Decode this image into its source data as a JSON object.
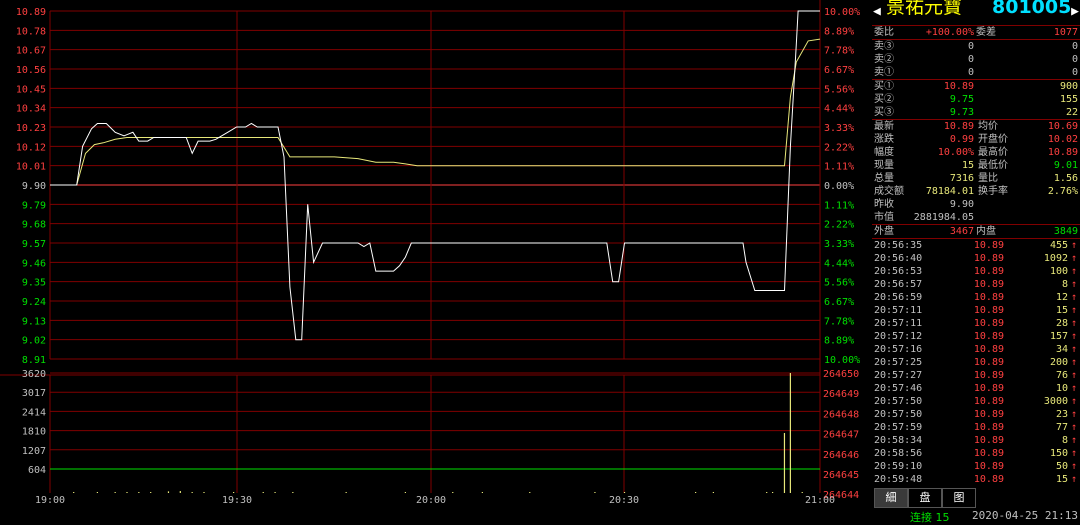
{
  "colors": {
    "background": "#000000",
    "grid": "#800000",
    "up": "#ff4040",
    "down": "#00e000",
    "price_line": "#ffffff",
    "avg_line": "#e8e87a",
    "title": "#ffff00",
    "code": "#00e0ff",
    "neutral": "#c0c0c0"
  },
  "stock": {
    "name": "景祐元寶",
    "code": "801005"
  },
  "price_axis": {
    "left": [
      "10.89",
      "10.78",
      "10.67",
      "10.56",
      "10.45",
      "10.34",
      "10.23",
      "10.12",
      "10.01",
      "9.90",
      "9.79",
      "9.68",
      "9.57",
      "9.46",
      "9.35",
      "9.24",
      "9.13",
      "9.02",
      "8.91"
    ],
    "right": [
      "10.00%",
      "8.89%",
      "7.78%",
      "6.67%",
      "5.56%",
      "4.44%",
      "3.33%",
      "2.22%",
      "1.11%",
      "0.00%",
      "1.11%",
      "2.22%",
      "3.33%",
      "4.44%",
      "5.56%",
      "6.67%",
      "7.78%",
      "8.89%",
      "10.00%"
    ]
  },
  "volume_axis": {
    "left": [
      "3620",
      "3017",
      "2414",
      "1810",
      "1207",
      "604"
    ],
    "right": [
      "264650",
      "264649",
      "264648",
      "264647",
      "264646",
      "264645",
      "264644"
    ]
  },
  "time_axis": [
    "19:00",
    "19:30",
    "20:00",
    "20:30",
    "21:00"
  ],
  "chart_data": {
    "type": "line",
    "y_range": [
      8.91,
      10.89
    ],
    "prev_close": 9.9,
    "x_range_minutes": [
      0,
      120
    ],
    "price": [
      [
        0,
        9.9
      ],
      [
        4.5,
        9.9
      ],
      [
        5.5,
        10.12
      ],
      [
        7,
        10.22
      ],
      [
        8,
        10.25
      ],
      [
        9.5,
        10.25
      ],
      [
        11,
        10.2
      ],
      [
        12.5,
        10.18
      ],
      [
        14,
        10.2
      ],
      [
        15,
        10.15
      ],
      [
        16.5,
        10.15
      ],
      [
        17.5,
        10.17
      ],
      [
        20,
        10.17
      ],
      [
        22,
        10.17
      ],
      [
        23,
        10.17
      ],
      [
        24,
        10.08
      ],
      [
        25,
        10.15
      ],
      [
        27,
        10.15
      ],
      [
        28,
        10.16
      ],
      [
        30,
        10.2
      ],
      [
        31.5,
        10.23
      ],
      [
        33,
        10.23
      ],
      [
        34,
        10.25
      ],
      [
        35,
        10.23
      ],
      [
        37,
        10.23
      ],
      [
        38.5,
        10.23
      ],
      [
        39.5,
        10.06
      ],
      [
        40.5,
        9.32
      ],
      [
        41.5,
        9.02
      ],
      [
        42.5,
        9.02
      ],
      [
        43.5,
        9.79
      ],
      [
        44.5,
        9.46
      ],
      [
        46,
        9.57
      ],
      [
        48,
        9.57
      ],
      [
        50,
        9.57
      ],
      [
        52,
        9.57
      ],
      [
        53,
        9.55
      ],
      [
        54,
        9.57
      ],
      [
        55,
        9.41
      ],
      [
        57,
        9.41
      ],
      [
        58,
        9.41
      ],
      [
        59,
        9.44
      ],
      [
        60,
        9.49
      ],
      [
        61,
        9.57
      ],
      [
        66,
        9.57
      ],
      [
        75,
        9.57
      ],
      [
        84,
        9.57
      ],
      [
        92,
        9.57
      ],
      [
        94,
        9.57
      ],
      [
        95,
        9.35
      ],
      [
        96,
        9.35
      ],
      [
        97,
        9.57
      ],
      [
        100,
        9.57
      ],
      [
        110,
        9.57
      ],
      [
        117,
        9.57
      ],
      [
        117.5,
        9.46
      ],
      [
        119,
        9.3
      ],
      [
        120,
        9.3
      ],
      [
        124,
        9.3
      ],
      [
        125,
        10.12
      ],
      [
        126,
        10.7
      ],
      [
        126.3,
        10.89
      ],
      [
        130,
        10.89
      ]
    ],
    "avg": [
      [
        0,
        9.9
      ],
      [
        4.5,
        9.9
      ],
      [
        6,
        10.08
      ],
      [
        7.5,
        10.13
      ],
      [
        9,
        10.14
      ],
      [
        11,
        10.16
      ],
      [
        13,
        10.17
      ],
      [
        16,
        10.17
      ],
      [
        20,
        10.17
      ],
      [
        24,
        10.17
      ],
      [
        30,
        10.17
      ],
      [
        38.5,
        10.17
      ],
      [
        40.5,
        10.06
      ],
      [
        48,
        10.06
      ],
      [
        52,
        10.05
      ],
      [
        55,
        10.03
      ],
      [
        58,
        10.03
      ],
      [
        60,
        10.02
      ],
      [
        62,
        10.01
      ],
      [
        70,
        10.01
      ],
      [
        90,
        10.01
      ],
      [
        110,
        10.01
      ],
      [
        124,
        10.01
      ],
      [
        125,
        10.4
      ],
      [
        126,
        10.6
      ],
      [
        128,
        10.72
      ],
      [
        130,
        10.73
      ]
    ],
    "volume_range": [
      0,
      3620
    ],
    "volume_series": [
      [
        4,
        1
      ],
      [
        8,
        2
      ],
      [
        11,
        1
      ],
      [
        13,
        1
      ],
      [
        15,
        20
      ],
      [
        17,
        3
      ],
      [
        20,
        50
      ],
      [
        22,
        60
      ],
      [
        24,
        24
      ],
      [
        26,
        3
      ],
      [
        31,
        8
      ],
      [
        36,
        6
      ],
      [
        38,
        4
      ],
      [
        41,
        3
      ],
      [
        50,
        15
      ],
      [
        60,
        8
      ],
      [
        68,
        3
      ],
      [
        73,
        3
      ],
      [
        81,
        7
      ],
      [
        92,
        2
      ],
      [
        97,
        2
      ],
      [
        109,
        4
      ],
      [
        112,
        2
      ],
      [
        121,
        6
      ],
      [
        122,
        7
      ],
      [
        124,
        1810
      ],
      [
        125,
        3620
      ],
      [
        127,
        1
      ]
    ],
    "volume_line_value": 604
  },
  "quote": {
    "weibi_label": "委比",
    "weibi_value": "+100.00%",
    "weicha_label": "委差",
    "weicha_value": "1077",
    "asks": [
      {
        "label": "卖③",
        "price": "0",
        "vol": "0"
      },
      {
        "label": "卖②",
        "price": "0",
        "vol": "0"
      },
      {
        "label": "卖①",
        "price": "0",
        "vol": "0"
      }
    ],
    "bids": [
      {
        "label": "买①",
        "price": "10.89",
        "vol": "900"
      },
      {
        "label": "买②",
        "price": "9.75",
        "vol": "155"
      },
      {
        "label": "买③",
        "price": "9.73",
        "vol": "22"
      }
    ],
    "stats": [
      {
        "l1": "最新",
        "v1": "10.89",
        "l2": "均价",
        "v2": "10.69"
      },
      {
        "l1": "涨跌",
        "v1": "0.99",
        "l2": "开盘价",
        "v2": "10.02"
      },
      {
        "l1": "幅度",
        "v1": "10.00%",
        "l2": "最高价",
        "v2": "10.89"
      },
      {
        "l1": "现量",
        "v1": "15",
        "l2": "最低价",
        "v2": "9.01"
      },
      {
        "l1": "总量",
        "v1": "7316",
        "l2": "量比",
        "v2": "1.56"
      },
      {
        "l1": "成交额",
        "v1": "78184.01",
        "l2": "换手率",
        "v2": "2.76%"
      },
      {
        "l1": "昨收",
        "v1": "9.90",
        "l2": "",
        "v2": ""
      },
      {
        "l1": "市值",
        "v1": "2881984.05",
        "l2": "",
        "v2": ""
      }
    ],
    "outer_label": "外盘",
    "outer_value": "3467",
    "inner_label": "内盘",
    "inner_value": "3849"
  },
  "ticks": [
    {
      "time": "20:56:35",
      "price": "10.89",
      "vol": "455"
    },
    {
      "time": "20:56:40",
      "price": "10.89",
      "vol": "1092"
    },
    {
      "time": "20:56:53",
      "price": "10.89",
      "vol": "100"
    },
    {
      "time": "20:56:57",
      "price": "10.89",
      "vol": "8"
    },
    {
      "time": "20:56:59",
      "price": "10.89",
      "vol": "12"
    },
    {
      "time": "20:57:11",
      "price": "10.89",
      "vol": "15"
    },
    {
      "time": "20:57:11",
      "price": "10.89",
      "vol": "28"
    },
    {
      "time": "20:57:12",
      "price": "10.89",
      "vol": "157"
    },
    {
      "time": "20:57:16",
      "price": "10.89",
      "vol": "34"
    },
    {
      "time": "20:57:25",
      "price": "10.89",
      "vol": "200"
    },
    {
      "time": "20:57:27",
      "price": "10.89",
      "vol": "76"
    },
    {
      "time": "20:57:46",
      "price": "10.89",
      "vol": "10"
    },
    {
      "time": "20:57:50",
      "price": "10.89",
      "vol": "3000"
    },
    {
      "time": "20:57:50",
      "price": "10.89",
      "vol": "23"
    },
    {
      "time": "20:57:59",
      "price": "10.89",
      "vol": "77"
    },
    {
      "time": "20:58:34",
      "price": "10.89",
      "vol": "8"
    },
    {
      "time": "20:58:56",
      "price": "10.89",
      "vol": "150"
    },
    {
      "time": "20:59:10",
      "price": "10.89",
      "vol": "50"
    },
    {
      "time": "20:59:48",
      "price": "10.89",
      "vol": "15"
    }
  ],
  "tick_arrow": "↑",
  "tabs": [
    "細",
    "盘",
    "图"
  ],
  "status": {
    "connection": "连接 15",
    "datetime": "2020-04-25 21:13"
  }
}
